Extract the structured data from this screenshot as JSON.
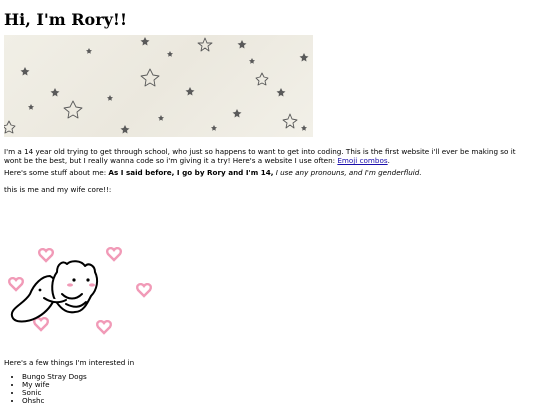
{
  "heading": "Hi, I'm Rory!!",
  "banner": {
    "icon": "stars-banner"
  },
  "intro": {
    "text": "I'm a 14 year old trying to get through school, who just so happens to want to get into coding. This is the first website i'll ever be making so it wont be the best, but I really wanna code so i'm giving it a try! Here's a website I use often: ",
    "link_label": "Emoji combos",
    "link_end": "."
  },
  "about": {
    "lead": "Here's some stuff about me: ",
    "bold": "As I said before, I go by Rory and I'm 14,",
    "italic": " I use any pronouns, and I'm genderfluid."
  },
  "core_caption": "this is me and my wife core!!:",
  "wifecore_image": {
    "icon": "cats-hugging-with-hearts"
  },
  "interests": {
    "heading": "Here's a few things I'm interested in",
    "items": [
      "Bungo Stray Dogs",
      "My wife",
      "Sonic",
      "Ohshc"
    ]
  },
  "colors": {
    "link": "#1a0dab",
    "banner_bg": "#efece3",
    "star": "#5a5a5a",
    "heart": "#f19ab7"
  }
}
